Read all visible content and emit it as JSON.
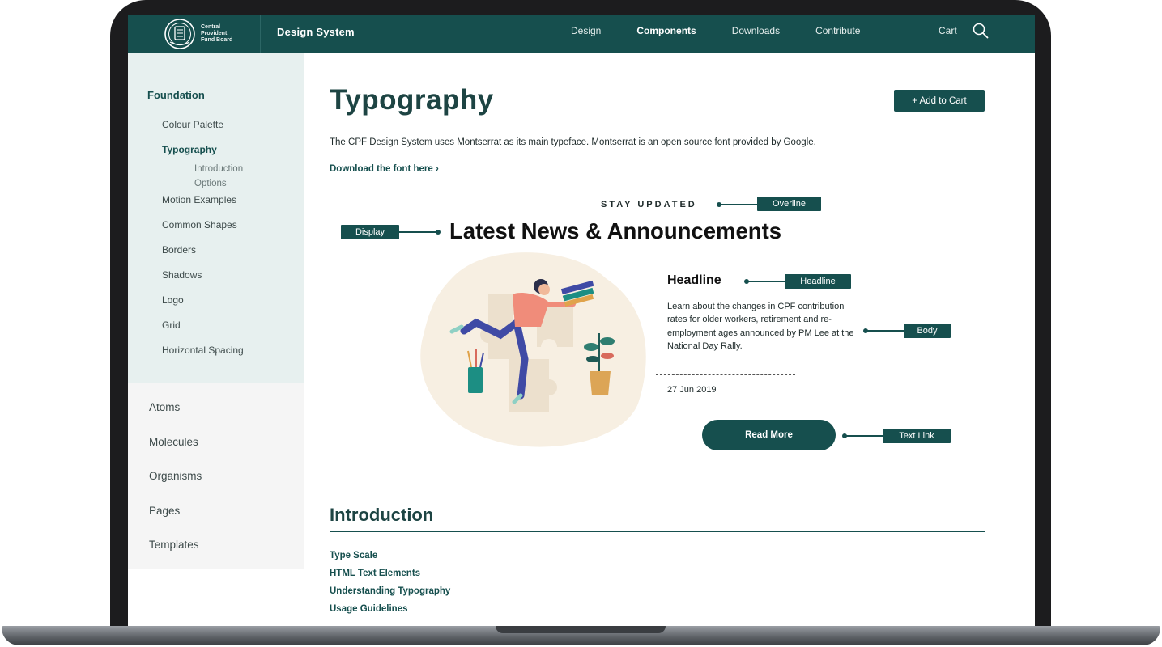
{
  "header": {
    "logo_text": [
      "Central",
      "Provident",
      "Fund Board"
    ],
    "site_title": "Design System",
    "nav": [
      "Design",
      "Components",
      "Downloads",
      "Contribute"
    ],
    "active_nav": "Components",
    "cart_label": "Cart",
    "icons": {
      "search": "search-icon",
      "logo": "cpf-seal-logo"
    }
  },
  "sidebar": {
    "section_heading": "Foundation",
    "items": [
      "Colour Palette",
      "Typography",
      "Motion Examples",
      "Common Shapes",
      "Borders",
      "Shadows",
      "Logo",
      "Grid",
      "Horizontal Spacing"
    ],
    "active_item": "Typography",
    "sub_items": [
      "Introduction",
      "Options"
    ],
    "categories": [
      "Atoms",
      "Molecules",
      "Organisms",
      "Pages",
      "Templates"
    ]
  },
  "main": {
    "title": "Typography",
    "add_to_cart": "+ Add to Cart",
    "intro": "The CPF Design System uses Montserrat as its main typeface. Montserrat is an open source font provided by Google.",
    "download_link": "Download the font here ›",
    "demo": {
      "overline": "STAY UPDATED",
      "display": "Latest News & Announcements",
      "headline": "Headline",
      "body": "Learn about the changes in CPF contribution rates for older workers, retirement and re-employment ages announced by PM Lee at the National Day Rally.",
      "date": "27 Jun 2019",
      "button": "Read More",
      "tags": {
        "overline": "Overline",
        "display": "Display",
        "headline": "Headline",
        "body": "Body",
        "text_link": "Text Link"
      }
    },
    "section_title": "Introduction",
    "toc": [
      "Type Scale",
      "HTML Text Elements",
      "Understanding Typography",
      "Usage Guidelines"
    ]
  },
  "colors": {
    "primary": "#164f4e",
    "sidebar_bg": "#e7f0ef",
    "sidebar_alt_bg": "#f5f5f5",
    "heading": "#1d4443"
  }
}
